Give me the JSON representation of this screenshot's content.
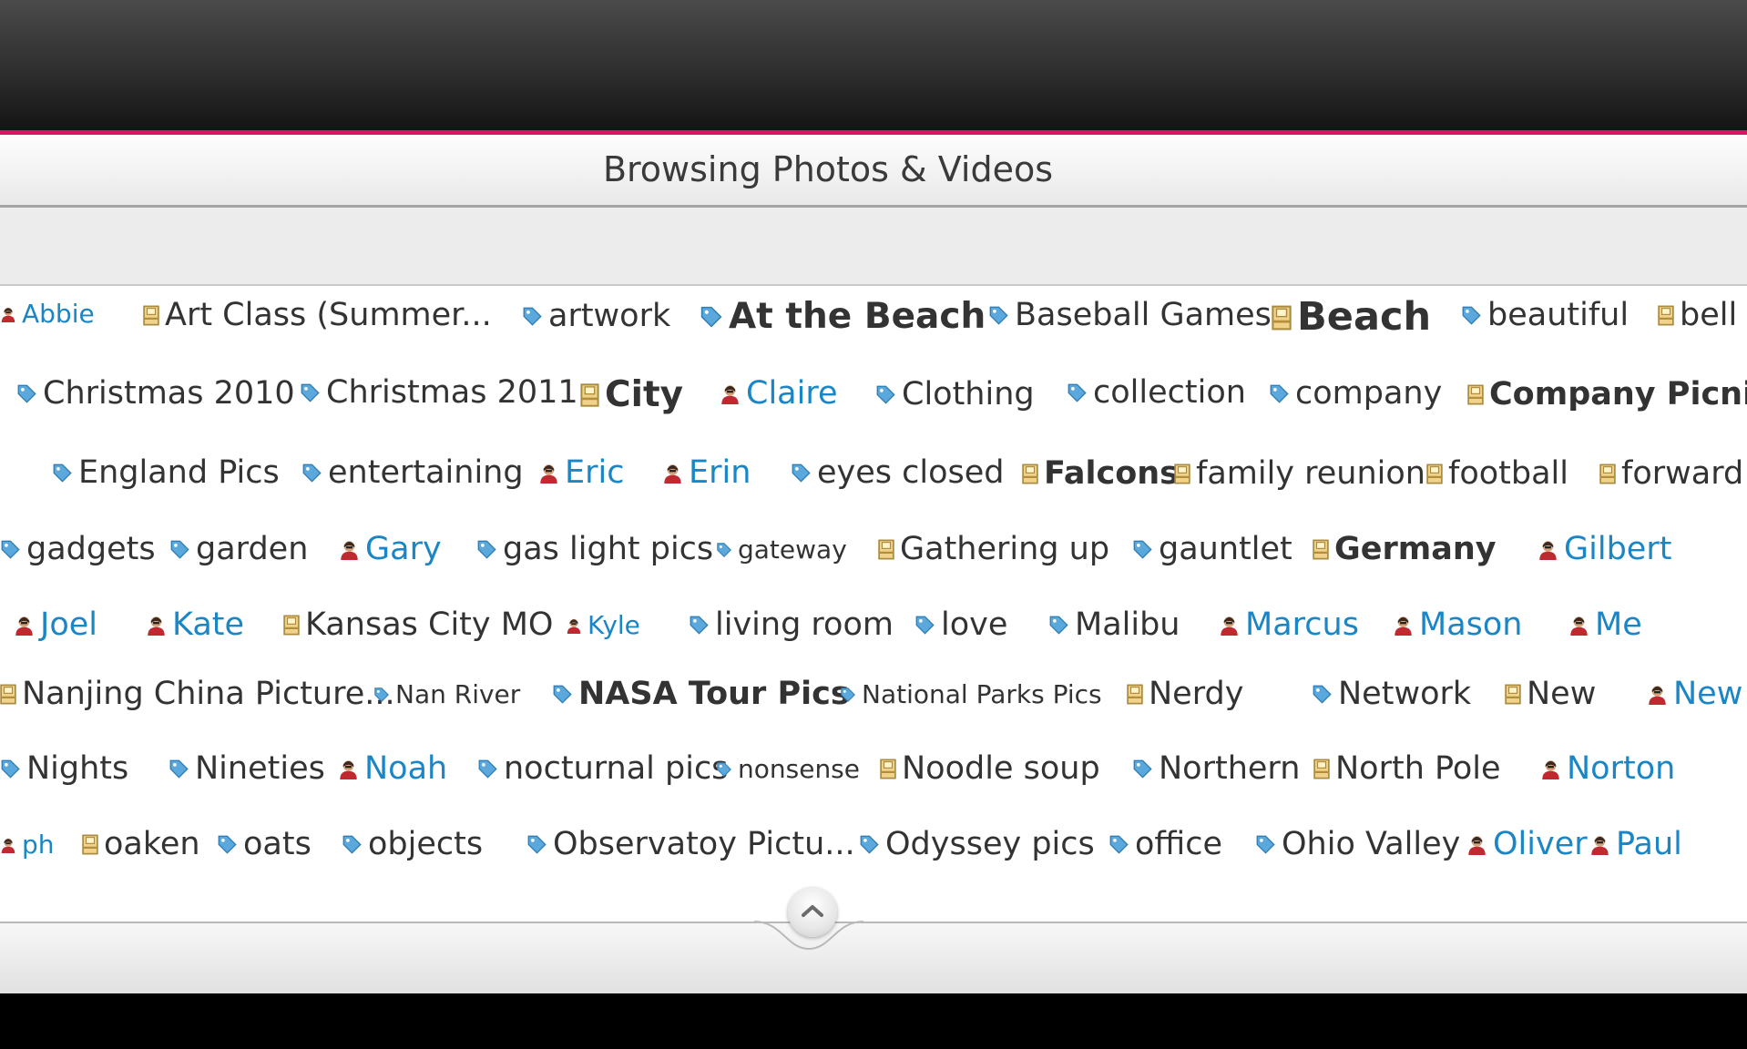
{
  "window": {
    "title": "Browsing Photos & Videos"
  },
  "colors": {
    "accent": "#d61563",
    "person_tag_text": "#1b86c6",
    "tag_text": "#333333"
  },
  "legend": {
    "person": "person-icon",
    "album": "album-icon",
    "keyword": "keyword-tag-icon"
  },
  "tags": [
    {
      "text": "Abbie",
      "type": "person",
      "size": "small"
    },
    {
      "text": "Art Class (Summer...",
      "type": "album",
      "size": "medium"
    },
    {
      "text": "artwork",
      "type": "keyword",
      "size": "medium"
    },
    {
      "text": "At the Beach",
      "type": "keyword",
      "size": "large",
      "bold": true
    },
    {
      "text": "Baseball Games",
      "type": "keyword",
      "size": "medium"
    },
    {
      "text": "Beach",
      "type": "album",
      "size": "xlarge",
      "bold": true
    },
    {
      "text": "beautiful",
      "type": "keyword",
      "size": "medium"
    },
    {
      "text": "bell",
      "type": "album",
      "size": "medium"
    },
    {
      "text": "Christmas 2010",
      "type": "keyword",
      "size": "medium"
    },
    {
      "text": "Christmas 2011",
      "type": "keyword",
      "size": "medium"
    },
    {
      "text": "City",
      "type": "album",
      "size": "large",
      "bold": true
    },
    {
      "text": "Claire",
      "type": "person",
      "size": "medium"
    },
    {
      "text": "Clothing",
      "type": "keyword",
      "size": "medium"
    },
    {
      "text": "collection",
      "type": "keyword",
      "size": "medium"
    },
    {
      "text": "company",
      "type": "keyword",
      "size": "medium"
    },
    {
      "text": "Company Picnics",
      "type": "album",
      "size": "medium",
      "bold": true
    },
    {
      "text": "England Pics",
      "type": "keyword",
      "size": "medium"
    },
    {
      "text": "entertaining",
      "type": "keyword",
      "size": "medium"
    },
    {
      "text": "Eric",
      "type": "person",
      "size": "medium"
    },
    {
      "text": "Erin",
      "type": "person",
      "size": "medium"
    },
    {
      "text": "eyes closed",
      "type": "keyword",
      "size": "medium"
    },
    {
      "text": "Falcons",
      "type": "album",
      "size": "medium",
      "bold": true
    },
    {
      "text": "family reunion",
      "type": "album",
      "size": "medium"
    },
    {
      "text": "football",
      "type": "album",
      "size": "medium"
    },
    {
      "text": "forward",
      "type": "album",
      "size": "medium"
    },
    {
      "text": "gadgets",
      "type": "keyword",
      "size": "medium"
    },
    {
      "text": "garden",
      "type": "keyword",
      "size": "medium"
    },
    {
      "text": "Gary",
      "type": "person",
      "size": "medium"
    },
    {
      "text": "gas light pics",
      "type": "keyword",
      "size": "medium"
    },
    {
      "text": "gateway",
      "type": "keyword",
      "size": "small"
    },
    {
      "text": "Gathering  up",
      "type": "album",
      "size": "medium"
    },
    {
      "text": "gauntlet",
      "type": "keyword",
      "size": "medium"
    },
    {
      "text": "Germany",
      "type": "album",
      "size": "medium",
      "bold": true
    },
    {
      "text": "Gilbert",
      "type": "person",
      "size": "medium"
    },
    {
      "text": "Joel",
      "type": "person",
      "size": "medium"
    },
    {
      "text": "Kate",
      "type": "person",
      "size": "medium"
    },
    {
      "text": "Kansas City MO",
      "type": "album",
      "size": "medium"
    },
    {
      "text": "Kyle",
      "type": "person",
      "size": "small"
    },
    {
      "text": "living room",
      "type": "keyword",
      "size": "medium"
    },
    {
      "text": "love",
      "type": "keyword",
      "size": "medium"
    },
    {
      "text": "Malibu",
      "type": "keyword",
      "size": "medium"
    },
    {
      "text": "Marcus",
      "type": "person",
      "size": "medium"
    },
    {
      "text": "Mason",
      "type": "person",
      "size": "medium"
    },
    {
      "text": "Me",
      "type": "person",
      "size": "medium"
    },
    {
      "text": "Nanjing China Picture...",
      "type": "album",
      "size": "medium"
    },
    {
      "text": "Nan River",
      "type": "keyword",
      "size": "small"
    },
    {
      "text": "NASA Tour Pics",
      "type": "keyword",
      "size": "medium",
      "bold": true
    },
    {
      "text": "National Parks Pics",
      "type": "keyword",
      "size": "small"
    },
    {
      "text": "Nerdy",
      "type": "album",
      "size": "medium"
    },
    {
      "text": "Network",
      "type": "keyword",
      "size": "medium"
    },
    {
      "text": "New",
      "type": "album",
      "size": "medium"
    },
    {
      "text": "New",
      "type": "person",
      "size": "medium"
    },
    {
      "text": "Nights",
      "type": "keyword",
      "size": "medium"
    },
    {
      "text": "Nineties",
      "type": "keyword",
      "size": "medium"
    },
    {
      "text": "Noah",
      "type": "person",
      "size": "medium"
    },
    {
      "text": "nocturnal pics",
      "type": "keyword",
      "size": "medium"
    },
    {
      "text": "nonsense",
      "type": "keyword",
      "size": "small"
    },
    {
      "text": "Noodle soup",
      "type": "album",
      "size": "medium"
    },
    {
      "text": "Northern",
      "type": "keyword",
      "size": "medium"
    },
    {
      "text": "North Pole",
      "type": "album",
      "size": "medium"
    },
    {
      "text": "Norton",
      "type": "person",
      "size": "medium"
    },
    {
      "text": "ph",
      "type": "person",
      "size": "small"
    },
    {
      "text": "oaken",
      "type": "album",
      "size": "medium"
    },
    {
      "text": "oats",
      "type": "keyword",
      "size": "medium"
    },
    {
      "text": "objects",
      "type": "keyword",
      "size": "medium"
    },
    {
      "text": "Observatoy Pictu...",
      "type": "keyword",
      "size": "medium"
    },
    {
      "text": "Odyssey pics",
      "type": "keyword",
      "size": "medium"
    },
    {
      "text": "office",
      "type": "keyword",
      "size": "medium"
    },
    {
      "text": "Ohio Valley",
      "type": "keyword",
      "size": "medium"
    },
    {
      "text": "Oliver",
      "type": "person",
      "size": "medium"
    },
    {
      "text": "Paul",
      "type": "person",
      "size": "medium"
    }
  ],
  "collapse": {
    "icon": "chevron-up-icon"
  }
}
